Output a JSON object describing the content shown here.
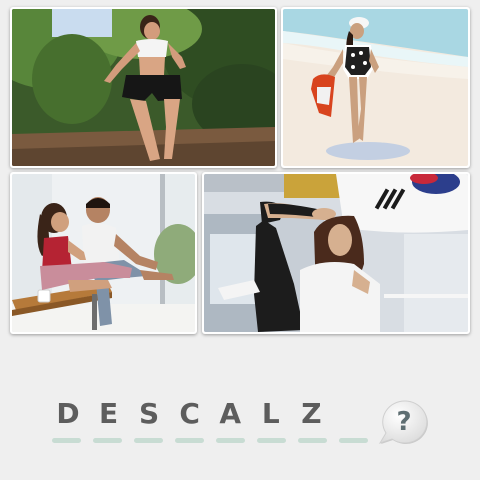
{
  "puzzle": {
    "answer_letters": [
      "D",
      "E",
      "S",
      "C",
      "A",
      "L",
      "Z",
      ""
    ],
    "slot_count": 8
  },
  "photos": [
    {
      "name": "photo-woman-running-outdoors",
      "icon": "photo"
    },
    {
      "name": "photo-woman-walking-on-beach",
      "icon": "photo"
    },
    {
      "name": "photo-couple-sitting-on-bench",
      "icon": "photo"
    },
    {
      "name": "photo-woman-martial-arts-kick",
      "icon": "photo"
    }
  ],
  "hint": {
    "mark": "?",
    "icon": "speech-bubble-icon"
  },
  "colors": {
    "background": "#efefef",
    "letter": "#5d5d5d",
    "slot": "#c8dcd3",
    "hint_mark": "#5e6e72"
  }
}
